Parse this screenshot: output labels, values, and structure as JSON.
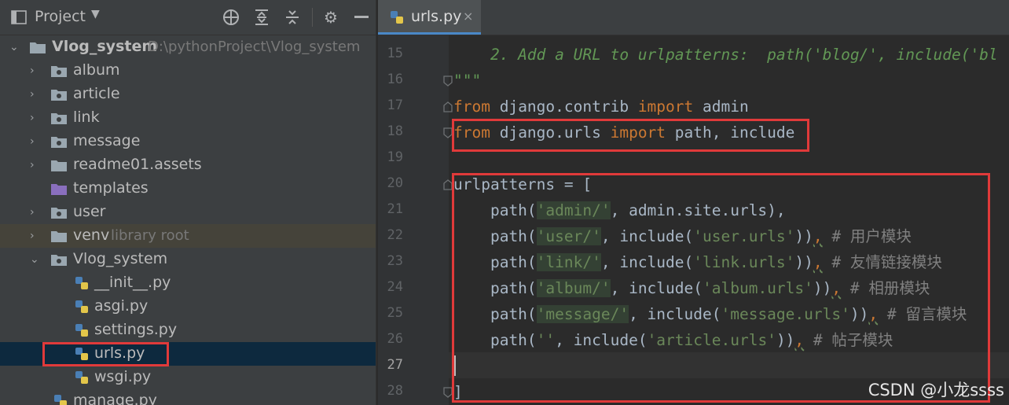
{
  "project_panel": {
    "title": "Project",
    "icons": [
      "globe-icon",
      "expand-all-icon",
      "collapse-all-icon",
      "gear-icon",
      "minimize-icon"
    ],
    "tree": [
      {
        "label": "Vlog_system",
        "hint": "D:\\pythonProject\\Vlog_system",
        "type": "folder",
        "expanded": true
      },
      {
        "label": "album",
        "type": "folder"
      },
      {
        "label": "article",
        "type": "folder"
      },
      {
        "label": "link",
        "type": "folder"
      },
      {
        "label": "message",
        "type": "folder"
      },
      {
        "label": "readme01.assets",
        "type": "folder"
      },
      {
        "label": "templates",
        "type": "folder-purple"
      },
      {
        "label": "user",
        "type": "folder"
      },
      {
        "label": "venv",
        "hint": "library root",
        "type": "folder"
      },
      {
        "label": "Vlog_system",
        "type": "folder",
        "expanded": true
      },
      {
        "label": "__init__.py",
        "type": "python-file"
      },
      {
        "label": "asgi.py",
        "type": "python-file"
      },
      {
        "label": "settings.py",
        "type": "python-file"
      },
      {
        "label": "urls.py",
        "type": "python-file",
        "selected": true
      },
      {
        "label": "wsgi.py",
        "type": "python-file"
      },
      {
        "label": "manage.py",
        "type": "python-file"
      }
    ]
  },
  "editor": {
    "tab": {
      "label": "urls.py",
      "close": "×"
    },
    "line_numbers": [
      "15",
      "16",
      "17",
      "18",
      "19",
      "20",
      "21",
      "22",
      "23",
      "24",
      "25",
      "26",
      "27",
      "28"
    ],
    "code": {
      "l15": "    2. Add a URL to urlpatterns:  path('blog/', include('bl",
      "l16": "\"\"\"",
      "l17_from": "from",
      "l17_mod": " django.contrib ",
      "l17_import": "import",
      "l17_rest": " admin",
      "l18_from": "from",
      "l18_mod": " django.urls ",
      "l18_import": "import",
      "l18_rest": " path, include",
      "l20": "urlpatterns = [",
      "l21_a": "    path(",
      "l21_s": "'admin/'",
      "l21_b": ", admin.site.urls),",
      "l22_a": "    path(",
      "l22_s": "'user/'",
      "l22_b": ", include(",
      "l22_s2": "'user.urls'",
      "l22_c": "))",
      "l22_comma": ",",
      "l22_cmt": " # 用户模块",
      "l23_a": "    path(",
      "l23_s": "'link/'",
      "l23_b": ", include(",
      "l23_s2": "'link.urls'",
      "l23_c": "))",
      "l23_comma": ",",
      "l23_cmt": " # 友情链接模块",
      "l24_a": "    path(",
      "l24_s": "'album/'",
      "l24_b": ", include(",
      "l24_s2": "'album.urls'",
      "l24_c": "))",
      "l24_comma": ",",
      "l24_cmt": " # 相册模块",
      "l25_a": "    path(",
      "l25_s": "'message/'",
      "l25_b": ", include(",
      "l25_s2": "'message.urls'",
      "l25_c": "))",
      "l25_comma": ",",
      "l25_cmt": " # 留言模块",
      "l26_a": "    path(",
      "l26_s": "''",
      "l26_b": ", include(",
      "l26_s2": "'article.urls'",
      "l26_c": "))",
      "l26_comma": ",",
      "l26_cmt": " # 帖子模块",
      "l28": "]"
    }
  },
  "watermark": "CSDN @小龙ssss",
  "colors": {
    "annotation_red": "#e03a3a",
    "selection": "#0d293e",
    "keyword": "#cc7832",
    "string": "#6a8759"
  }
}
